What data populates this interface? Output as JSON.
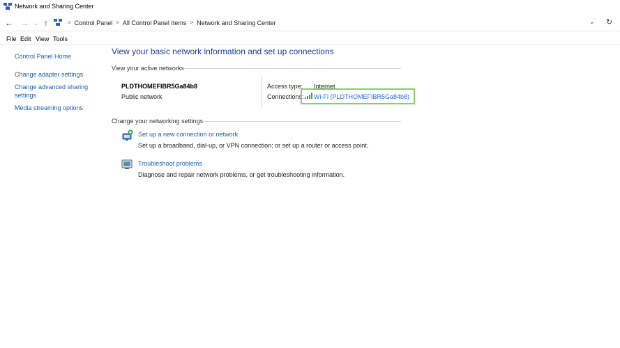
{
  "window": {
    "title": "Network and Sharing Center"
  },
  "address": {
    "crumbs": [
      "Control Panel",
      "All Control Panel Items",
      "Network and Sharing Center"
    ],
    "back": "←",
    "forward": "→",
    "history": "⌄",
    "up": "↑",
    "dropdown": "⌄",
    "refresh": "↻",
    "sep": ">"
  },
  "menu": {
    "file": "File",
    "edit": "Edit",
    "view": "View",
    "tools": "Tools"
  },
  "left_nav": {
    "home": "Control Panel Home",
    "adapter": "Change adapter settings",
    "advanced_line1": "Change advanced sharing",
    "advanced_line2": "settings",
    "media": "Media streaming options"
  },
  "main": {
    "title": "View your basic network information and set up connections",
    "active_networks_label": "View your active networks",
    "network": {
      "name": "PLDTHOMEFIBR5Ga84b8",
      "type": "Public network",
      "access_type_label": "Access type:",
      "access_type_value": "Internet",
      "connections_label": "Connections:",
      "connection_link": "Wi-Fi (PLDTHOMEFIBR5Ga84b8)"
    },
    "change_settings_label": "Change your networking settings",
    "tasks": [
      {
        "title": "Set up a new connection or network",
        "desc": "Set up a broadband, dial-up, or VPN connection; or set up a router or access point.",
        "icon": "new-connection-icon"
      },
      {
        "title": "Troubleshoot problems",
        "desc": "Diagnose and repair network problems, or get troubleshooting information.",
        "icon": "troubleshoot-icon"
      }
    ]
  },
  "colors": {
    "link": "#1c5fa8",
    "title": "#1e3d8f",
    "highlight": "#7ed36a"
  }
}
